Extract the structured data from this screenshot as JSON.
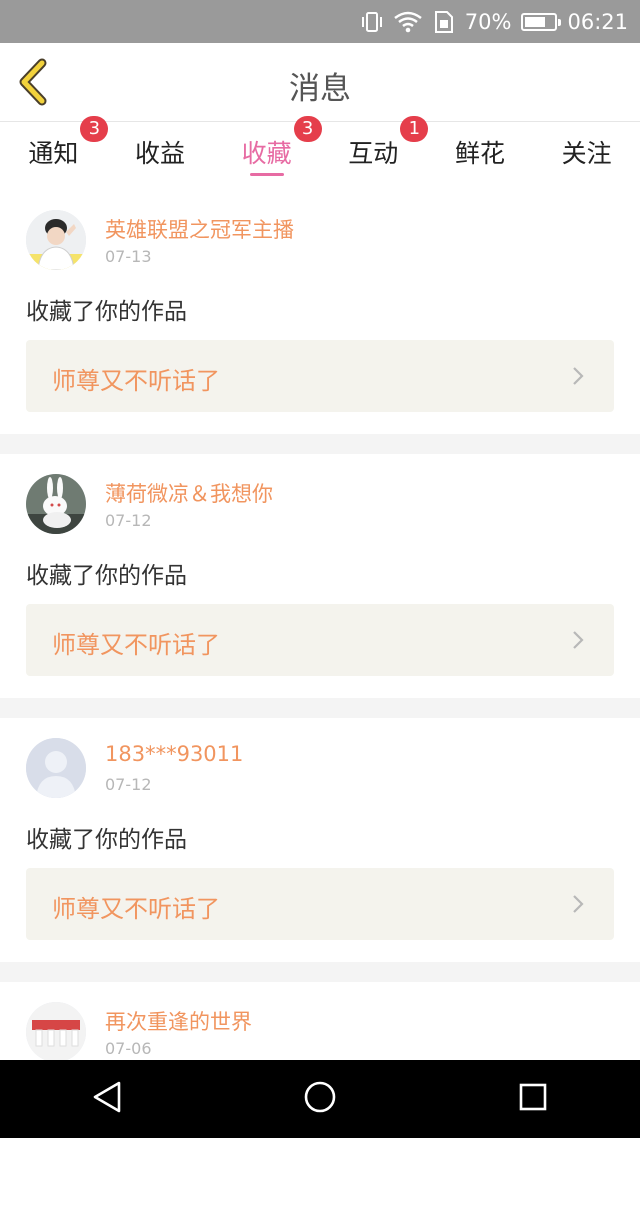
{
  "status_bar": {
    "battery_percent": "70%",
    "battery_level": 0.7,
    "time": "06:21",
    "icons": [
      "vibrate-icon",
      "wifi-icon",
      "sim-icon",
      "battery-icon"
    ]
  },
  "header": {
    "title": "消息",
    "back_icon": "chevron-left-icon"
  },
  "tabs": [
    {
      "label": "通知",
      "badge": "3",
      "active": false
    },
    {
      "label": "收益",
      "badge": "",
      "active": false
    },
    {
      "label": "收藏",
      "badge": "3",
      "active": true
    },
    {
      "label": "互动",
      "badge": "1",
      "active": false
    },
    {
      "label": "鲜花",
      "badge": "",
      "active": false
    },
    {
      "label": "关注",
      "badge": "",
      "active": false
    }
  ],
  "messages": [
    {
      "username": "英雄联盟之冠军主播",
      "date": "07-13",
      "action": "收藏了你的作品",
      "work_title": "师尊又不听话了"
    },
    {
      "username": "薄荷微凉＆我想你",
      "date": "07-12",
      "action": "收藏了你的作品",
      "work_title": "师尊又不听话了"
    },
    {
      "username": "183***93011",
      "date": "07-12",
      "action": "收藏了你的作品",
      "work_title": "师尊又不听话了"
    },
    {
      "username": "再次重逢的世界",
      "date": "07-06",
      "action": "",
      "work_title": ""
    }
  ],
  "colors": {
    "accent_pink": "#e76ba3",
    "username_orange": "#f1955f",
    "badge_red": "#e53e4b",
    "back_yellow": "#f2d23c"
  },
  "navbar": {
    "icons": [
      "back-triangle-icon",
      "home-circle-icon",
      "recents-square-icon"
    ]
  }
}
